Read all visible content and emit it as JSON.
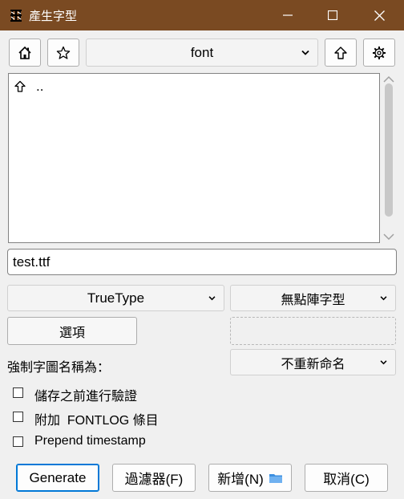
{
  "window": {
    "title": "產生字型",
    "app_icon": "fontforge-icon",
    "controls": [
      "minimize-icon",
      "maximize-icon",
      "close-icon"
    ]
  },
  "toolbar": {
    "home_icon": "home-icon",
    "bookmark_icon": "star-icon",
    "path_value": "font",
    "up_icon": "arrow-up-icon",
    "settings_icon": "gear-icon"
  },
  "file_list": {
    "items": [
      {
        "icon": "arrow-up-icon",
        "label": ".."
      }
    ]
  },
  "filename": {
    "value": "test.ttf"
  },
  "format": {
    "outline_selected": "TrueType",
    "bitmap_selected": "無點陣字型"
  },
  "options_button": "選項",
  "force_name": {
    "label": "強制字圖名稱為：",
    "selected": "不重新命名"
  },
  "checkboxes": [
    {
      "label": "儲存之前進行驗證",
      "checked": false
    },
    {
      "label": "附加  FONTLOG 條目",
      "checked": false
    },
    {
      "label": "Prepend timestamp",
      "checked": false
    }
  ],
  "buttons": {
    "generate": "Generate",
    "filter": "過濾器(F)",
    "new": "新增(N)",
    "new_icon": "folder-icon",
    "cancel": "取消(C)"
  },
  "colors": {
    "titlebar": "#7a4a22",
    "accent": "#0078d7",
    "folder": "#3c8fe0"
  }
}
